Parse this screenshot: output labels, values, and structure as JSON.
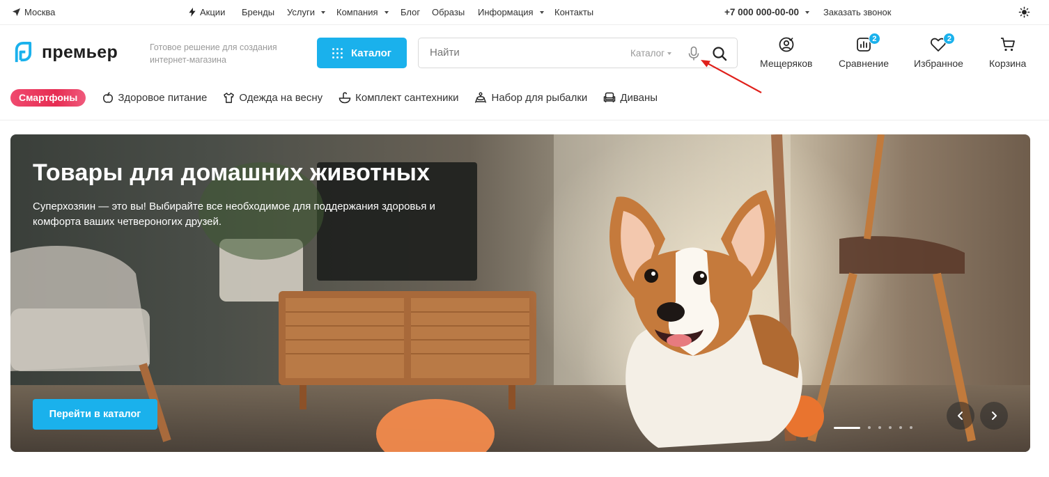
{
  "topbar": {
    "city": "Москва",
    "nav": [
      {
        "label": "Акции"
      },
      {
        "label": "Бренды"
      },
      {
        "label": "Услуги"
      },
      {
        "label": "Компания"
      },
      {
        "label": "Блог"
      },
      {
        "label": "Образы"
      },
      {
        "label": "Информация"
      },
      {
        "label": "Контакты"
      }
    ],
    "phone": "+7 000 000-00-00",
    "callback": "Заказать звонок"
  },
  "header": {
    "logo_text": "премьер",
    "slogan": "Готовое решение для создания интернет-магазина",
    "catalog_label": "Каталог",
    "search": {
      "placeholder": "Найти",
      "scope": "Каталог"
    },
    "actions": [
      {
        "label": "Мещеряков"
      },
      {
        "label": "Сравнение",
        "badge": "2"
      },
      {
        "label": "Избранное",
        "badge": "2"
      },
      {
        "label": "Корзина"
      }
    ]
  },
  "quick_categories": {
    "highlight": "Смартфоны",
    "items": [
      {
        "label": "Здоровое питание",
        "icon": "apple-icon"
      },
      {
        "label": "Одежда на весну",
        "icon": "shirt-icon"
      },
      {
        "label": "Комплект сантехники",
        "icon": "sink-icon"
      },
      {
        "label": "Набор для рыбалки",
        "icon": "fishing-icon"
      },
      {
        "label": "Диваны",
        "icon": "sofa-icon"
      }
    ]
  },
  "banner": {
    "title": "Товары для домашних животных",
    "text": "Суперхозяин — это вы! Выбирайте все необходимое для поддержания здоровья и комфорта ваших четвероногих друзей.",
    "button": "Перейти в каталог",
    "slide_index": 1,
    "slide_count": 7
  },
  "colors": {
    "accent": "#1ab1ec",
    "highlight": "#e62c52",
    "annotation": "#e0201b"
  }
}
